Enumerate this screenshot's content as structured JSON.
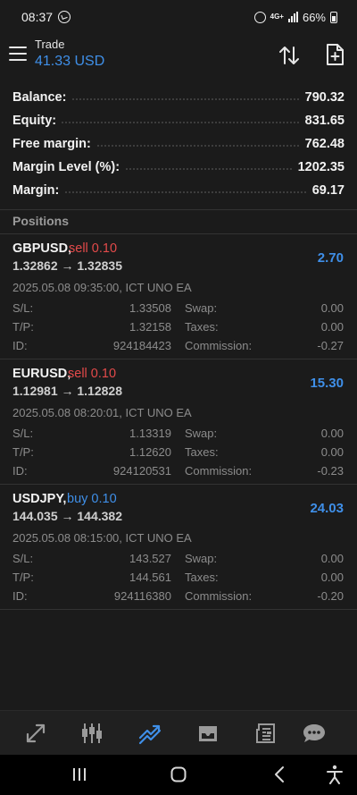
{
  "status_bar": {
    "time": "08:37",
    "network": "4G+",
    "battery": "66%"
  },
  "header": {
    "title": "Trade",
    "subtitle": "41.33 USD"
  },
  "summary": [
    {
      "label": "Balance:",
      "value": "790.32"
    },
    {
      "label": "Equity:",
      "value": "831.65"
    },
    {
      "label": "Free margin:",
      "value": "762.48"
    },
    {
      "label": "Margin Level (%):",
      "value": "1202.35"
    },
    {
      "label": "Margin:",
      "value": "69.17"
    }
  ],
  "positions_title": "Positions",
  "positions": [
    {
      "symbol": "GBPUSD,",
      "side": "sell 0.10",
      "side_type": "sell",
      "prices": "1.32862 → 1.32835",
      "profit": "2.70",
      "meta": "2025.05.08 09:35:00, ICT UNO EA",
      "sl_label": "S/L:",
      "sl": "1.33508",
      "tp_label": "T/P:",
      "tp": "1.32158",
      "id_label": "ID:",
      "id": "924184423",
      "swap_label": "Swap:",
      "swap": "0.00",
      "taxes_label": "Taxes:",
      "taxes": "0.00",
      "commission_label": "Commission:",
      "commission": "-0.27"
    },
    {
      "symbol": "EURUSD,",
      "side": "sell 0.10",
      "side_type": "sell",
      "prices": "1.12981 → 1.12828",
      "profit": "15.30",
      "meta": "2025.05.08 08:20:01, ICT UNO EA",
      "sl_label": "S/L:",
      "sl": "1.13319",
      "tp_label": "T/P:",
      "tp": "1.12620",
      "id_label": "ID:",
      "id": "924120531",
      "swap_label": "Swap:",
      "swap": "0.00",
      "taxes_label": "Taxes:",
      "taxes": "0.00",
      "commission_label": "Commission:",
      "commission": "-0.23"
    },
    {
      "symbol": "USDJPY,",
      "side": "buy 0.10",
      "side_type": "buy",
      "prices": "144.035 → 144.382",
      "profit": "24.03",
      "meta": "2025.05.08 08:15:00, ICT UNO EA",
      "sl_label": "S/L:",
      "sl": "143.527",
      "tp_label": "T/P:",
      "tp": "144.561",
      "id_label": "ID:",
      "id": "924116380",
      "swap_label": "Swap:",
      "swap": "0.00",
      "taxes_label": "Taxes:",
      "taxes": "0.00",
      "commission_label": "Commission:",
      "commission": "-0.20"
    }
  ],
  "bottom_nav": [
    "quotes-icon",
    "chart-icon",
    "trade-icon",
    "history-icon",
    "news-icon",
    "chat-icon"
  ],
  "colors": {
    "accent": "#3f8fe8",
    "sell": "#e34a4a",
    "background": "#1b1b1b"
  }
}
